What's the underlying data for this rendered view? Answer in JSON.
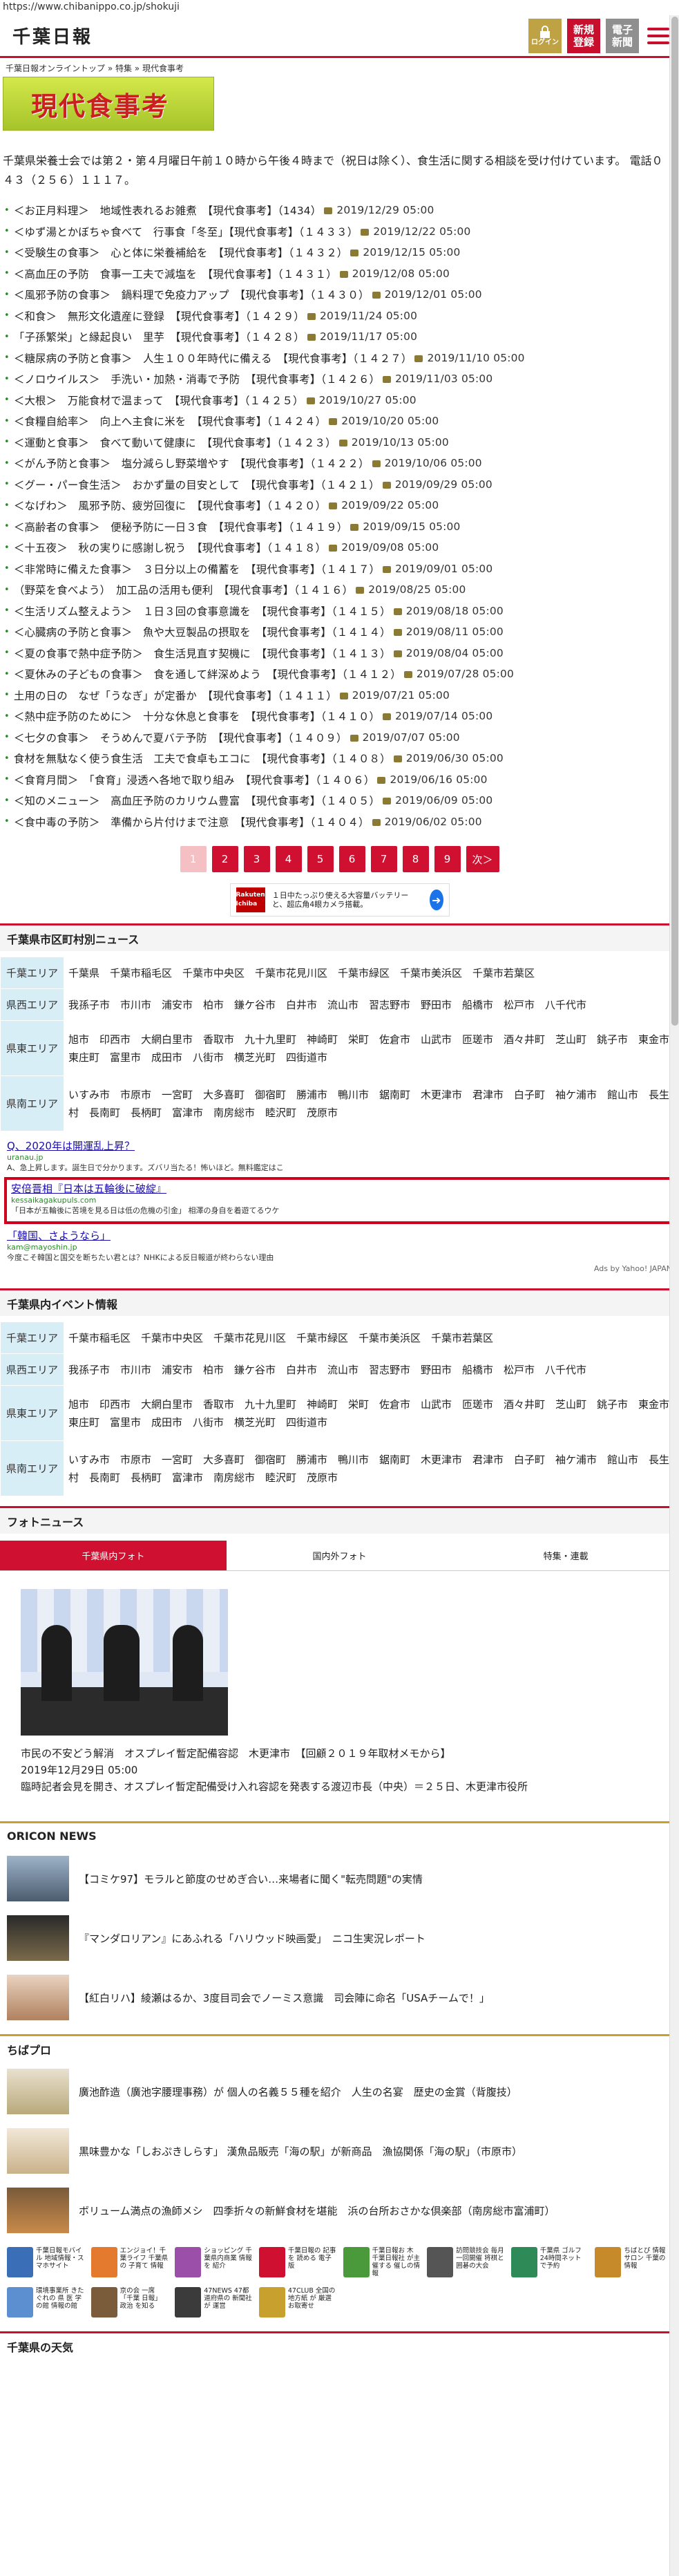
{
  "url": "https://www.chibanippo.co.jp/shokuji",
  "header": {
    "logo": "千葉日報",
    "login": "ログイン",
    "register_1": "新規",
    "register_2": "登録",
    "newspaper_1": "電子",
    "newspaper_2": "新聞"
  },
  "breadcrumb": "千葉日報オンライントップ » 特集 » 現代食事考",
  "banner_title": "現代食事考",
  "intro": "千葉県栄養士会では第２・第４月曜日午前１０時から午後４時まで（祝日は除く）、食生活に関する相談を受け付けています。 電話０４３（２５６）１１１７。",
  "articles": [
    {
      "title": "＜お正月料理＞　地域性表れるお雑煮　【現代食事考】（1434）",
      "date": "2019/12/29 05:00"
    },
    {
      "title": "＜ゆず湯とかぼちゃ食べて　行事食「冬至」【現代食事考】（１４３３）",
      "date": "2019/12/22 05:00"
    },
    {
      "title": "＜受験生の食事＞　心と体に栄養補給を　【現代食事考】（１４３２）",
      "date": "2019/12/15 05:00"
    },
    {
      "title": "＜高血圧の予防　食事一工夫で減塩を　【現代食事考】（１４３１）",
      "date": "2019/12/08 05:00"
    },
    {
      "title": "＜風邪予防の食事＞　鍋料理で免疫力アップ　【現代食事考】（１４３０）",
      "date": "2019/12/01 05:00"
    },
    {
      "title": "＜和食＞　無形文化遺産に登録　【現代食事考】（１４２９）",
      "date": "2019/11/24 05:00"
    },
    {
      "title": "「子孫繁栄」と縁起良い　里芋　【現代食事考】（１４２８）",
      "date": "2019/11/17 05:00"
    },
    {
      "title": "＜糖尿病の予防と食事＞　人生１００年時代に備える　【現代食事考】（１４２７）",
      "date": "2019/11/10 05:00"
    },
    {
      "title": "＜ノロウイルス＞　手洗い・加熱・消毒で予防　【現代食事考】（１４２６）",
      "date": "2019/11/03 05:00"
    },
    {
      "title": "＜大根＞　万能食材で温まって　【現代食事考】（１４２５）",
      "date": "2019/10/27 05:00"
    },
    {
      "title": "＜食糧自給率＞　向上へ主食に米を　【現代食事考】（１４２４）",
      "date": "2019/10/20 05:00"
    },
    {
      "title": "＜運動と食事＞　食べて動いて健康に　【現代食事考】（１４２３）",
      "date": "2019/10/13 05:00"
    },
    {
      "title": "＜がん予防と食事＞　塩分減らし野菜増やす　【現代食事考】（１４２２）",
      "date": "2019/10/06 05:00"
    },
    {
      "title": "＜グー・パー食生活＞　おかず量の目安として　【現代食事考】（１４２１）",
      "date": "2019/09/29 05:00"
    },
    {
      "title": "＜なげわ＞　風邪予防、疲労回復に　【現代食事考】（１４２０）",
      "date": "2019/09/22 05:00"
    },
    {
      "title": "＜高齢者の食事＞　便秘予防に一日３食　【現代食事考】（１４１９）",
      "date": "2019/09/15 05:00"
    },
    {
      "title": "＜十五夜＞　秋の実りに感謝し祝う　【現代食事考】（１４１８）",
      "date": "2019/09/08 05:00"
    },
    {
      "title": "＜非常時に備えた食事＞　３日分以上の備蓄を　【現代食事考】（１４１７）",
      "date": "2019/09/01 05:00"
    },
    {
      "title": "（野菜を食べよう）　加工品の活用も便利　【現代食事考】（１４１６）",
      "date": "2019/08/25 05:00"
    },
    {
      "title": "＜生活リズム整えよう＞　１日３回の食事意識を　【現代食事考】（１４１５）",
      "date": "2019/08/18 05:00"
    },
    {
      "title": "＜心臓病の予防と食事＞　魚や大豆製品の摂取を　【現代食事考】（１４１４）",
      "date": "2019/08/11 05:00"
    },
    {
      "title": "＜夏の食事で熱中症予防＞　食生活見直す契機に　【現代食事考】（１４１３）",
      "date": "2019/08/04 05:00"
    },
    {
      "title": "＜夏休みの子どもの食事＞　食を通して絆深めよう　【現代食事考】（１４１２）",
      "date": "2019/07/28 05:00"
    },
    {
      "title": "土用の日の　なぜ「うなぎ」が定番か　【現代食事考】（１４１１）",
      "date": "2019/07/21 05:00"
    },
    {
      "title": "＜熱中症予防のために＞　十分な休息と食事を　【現代食事考】（１４１０）",
      "date": "2019/07/14 05:00"
    },
    {
      "title": "＜七夕の食事＞　そうめんで夏バテ予防　【現代食事考】（１４０９）",
      "date": "2019/07/07 05:00"
    },
    {
      "title": "食材を無駄なく使う食生活　工夫で食卓もエコに　【現代食事考】（１４０８）",
      "date": "2019/06/30 05:00"
    },
    {
      "title": "＜食育月間＞　「食育」浸透へ各地で取り組み　【現代食事考】（１４０６）",
      "date": "2019/06/16 05:00"
    },
    {
      "title": "＜知のメニュー＞　高血圧予防のカリウム豊富　【現代食事考】（１４０５）",
      "date": "2019/06/09 05:00"
    },
    {
      "title": "＜食中毒の予防＞　準備から片付けまで注意　【現代食事考】（１４０４）",
      "date": "2019/06/02 05:00"
    }
  ],
  "pagination": [
    "1",
    "2",
    "3",
    "4",
    "5",
    "6",
    "7",
    "8",
    "9",
    "次＞"
  ],
  "ad_top": {
    "brand": "Rakuten Ichiba",
    "text": "１日中たっぷり使える大容量バッテリーと、超広角4眼カメラ搭載。"
  },
  "news_section": {
    "title": "千葉県市区町村別ニュース",
    "areas": [
      {
        "label": "千葉エリア",
        "towns": "千葉県　千葉市稲毛区　千葉市中央区　千葉市花見川区　千葉市緑区　千葉市美浜区　千葉市若葉区"
      },
      {
        "label": "県西エリア",
        "towns": "我孫子市　市川市　浦安市　柏市　鎌ケ谷市　白井市　流山市　習志野市　野田市　船橋市　松戸市　八千代市"
      },
      {
        "label": "県東エリア",
        "towns": "旭市　印西市　大網白里市　香取市　九十九里町　神崎町　栄町　佐倉市　山武市　匝瑳市　酒々井町　芝山町　銚子市　東金市　東庄町　富里市　成田市　八街市　横芝光町　四街道市"
      },
      {
        "label": "県南エリア",
        "towns": "いすみ市　市原市　一宮町　大多喜町　御宿町　勝浦市　鴨川市　鋸南町　木更津市　君津市　白子町　袖ケ浦市　館山市　長生村　長南町　長柄町　富津市　南房総市　睦沢町　茂原市"
      }
    ]
  },
  "yahoo_ads": [
    {
      "title": "Q、2020年は開運乱上昇？",
      "url": "uranau.jp",
      "desc": "A、急上昇します。誕生日で分かります。ズバリ当たる！怖いほど。無料鑑定はこ"
    },
    {
      "title": "安倍晋相『日本は五輪後に破綻』",
      "url": "kessaikagakupuls.com",
      "desc": "「日本が五輪後に苦境を見る日は低の危機の引金」 相澤の身自を着遊てるウケ"
    },
    {
      "title": "「韓国、さようなら」",
      "url": "kam@mayoshin.jp",
      "desc": "今度こそ韓国と国交を断ちたい君とは？NHKによる反日報道が終わらない理由"
    }
  ],
  "yahoo_footer": "Ads by Yahoo! JAPAN",
  "event_section": {
    "title": "千葉県内イベント情報",
    "areas": [
      {
        "label": "千葉エリア",
        "towns": "千葉市稲毛区　千葉市中央区　千葉市花見川区　千葉市緑区　千葉市美浜区　千葉市若葉区"
      },
      {
        "label": "県西エリア",
        "towns": "我孫子市　市川市　浦安市　柏市　鎌ケ谷市　白井市　流山市　習志野市　野田市　船橋市　松戸市　八千代市"
      },
      {
        "label": "県東エリア",
        "towns": "旭市　印西市　大網白里市　香取市　九十九里町　神崎町　栄町　佐倉市　山武市　匝瑳市　酒々井町　芝山町　銚子市　東金市　東庄町　富里市　成田市　八街市　横芝光町　四街道市"
      },
      {
        "label": "県南エリア",
        "towns": "いすみ市　市原市　一宮町　大多喜町　御宿町　勝浦市　鴨川市　鋸南町　木更津市　君津市　白子町　袖ケ浦市　館山市　長生村　長南町　長柄町　富津市　南房総市　睦沢町　茂原市"
      }
    ]
  },
  "photo_news": {
    "title": "フォトニュース",
    "tabs": [
      "千葉県内フォト",
      "国内外フォト",
      "特集・連載"
    ],
    "caption": "市民の不安どう解消　オスプレイ暫定配備容認　木更津市　【回顧２０１９年取材メモから】",
    "date": "2019年12月29日 05:00",
    "summary": "臨時記者会見を開き、オスプレイ暫定配備受け入れ容認を発表する渡辺市長（中央）＝２５日、木更津市役所"
  },
  "oricon": {
    "title": "ORICON NEWS",
    "items": [
      "【コミケ97】モラルと節度のせめぎ合い…来場者に聞く\"転売問題\"の実情",
      "『マンダロリアン』にあふれる「ハリウッド映画愛」　ニコ生実況レポート",
      "【紅白リハ】綾瀬はるか、3度目司会でノーミス意識　司会陣に命名「USAチームで！」"
    ]
  },
  "chibapro": {
    "title": "ちばプロ",
    "items": [
      "廣池酢造（廣池字腰理事務）が 個人の名義５５種を紹介　人生の名宴　歴史の金賞（背腹技）",
      "黒味豊かな「しおぷきしらす」 漢魚品販売「海の駅」が新商品　漁協関係「海の駅」（市原市）",
      "ボリューム満点の漁師メシ　四季折々の新鮮食材を堪能　浜の台所おさかな倶楽部（南房総市富浦町）"
    ]
  },
  "links": [
    {
      "label": "千葉日報モバイル 地域情報・ス マホサイト",
      "color": "#3a6fb7"
    },
    {
      "label": "エンジョイ！千葉ライフ 千葉県の 子育て 情報",
      "color": "#e47a2e"
    },
    {
      "label": "ショッピング 千葉県内商業 情報を 紹介",
      "color": "#9b4fa8"
    },
    {
      "label": "千葉日報の 記事を 読める 電子版",
      "color": "#d01030"
    },
    {
      "label": "千葉日報お 木 千葉日報社 が主催する 催しの情報",
      "color": "#4a9a3c"
    },
    {
      "label": "訪問競技会 毎月一回開催 将棋と 囲碁の大会",
      "color": "#555555"
    },
    {
      "label": "千葉県 ゴルフ 24時間ネット で予約",
      "color": "#2e8b57"
    },
    {
      "label": "ちばとぴ 情報 サロン 千葉の 情報",
      "color": "#c78a2b"
    },
    {
      "label": "環境事業所 きたぐれの 県 医 学 の館 情報の館",
      "color": "#5b8fd0"
    },
    {
      "label": "京の会 一席 「千葉 日報」 政治 を知る",
      "color": "#7a5c3a"
    },
    {
      "label": "47NEWS 47都道府県の 新聞社 が 運営",
      "color": "#3b3b3b"
    },
    {
      "label": "47CLUB 全国の 地方紙 が 厳選 お取寄せ",
      "color": "#c8a02e"
    }
  ],
  "footer_section": "千葉県の天気"
}
